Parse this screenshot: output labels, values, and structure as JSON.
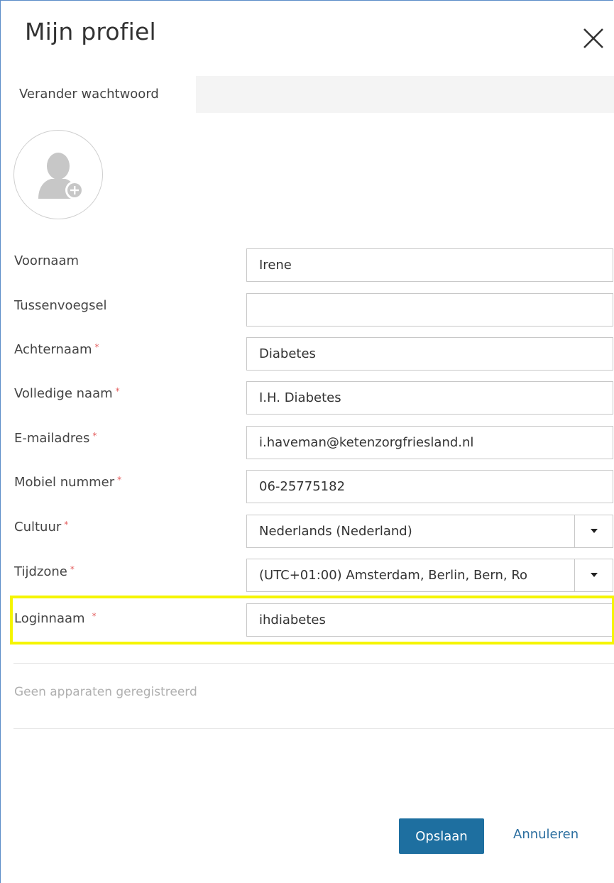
{
  "dialog": {
    "title": "Mijn profiel",
    "close_icon": "close-icon"
  },
  "tabs": [
    {
      "label": "Verander wachtwoord"
    }
  ],
  "avatar": {
    "icon": "user-add-icon"
  },
  "fields": [
    {
      "label": "Voornaam",
      "required": false,
      "value": "Irene"
    },
    {
      "label": "Tussenvoegsel",
      "required": false,
      "value": ""
    },
    {
      "label": "Achternaam",
      "required": true,
      "value": "Diabetes"
    },
    {
      "label": "Volledige naam",
      "required": true,
      "value": "I.H. Diabetes"
    },
    {
      "label": "E-mailadres",
      "required": true,
      "value": "i.haveman@ketenzorgfriesland.nl"
    },
    {
      "label": "Mobiel nummer",
      "required": true,
      "value": "06-25775182"
    },
    {
      "label": "Cultuur",
      "required": true,
      "value": "Nederlands (Nederland)",
      "type": "select"
    },
    {
      "label": "Tijdzone",
      "required": true,
      "value": "(UTC+01:00) Amsterdam, Berlin, Bern, Ro",
      "type": "select"
    },
    {
      "label": "Loginnaam",
      "required": true,
      "value": "ihdiabetes",
      "highlighted": true
    }
  ],
  "required_mark": "*",
  "devices": {
    "empty_text": "Geen apparaten geregistreerd"
  },
  "actions": {
    "save_label": "Opslaan",
    "cancel_label": "Annuleren"
  },
  "colors": {
    "primary": "#1e6fa0",
    "required": "#e35b5b",
    "highlight": "#f5f500"
  }
}
